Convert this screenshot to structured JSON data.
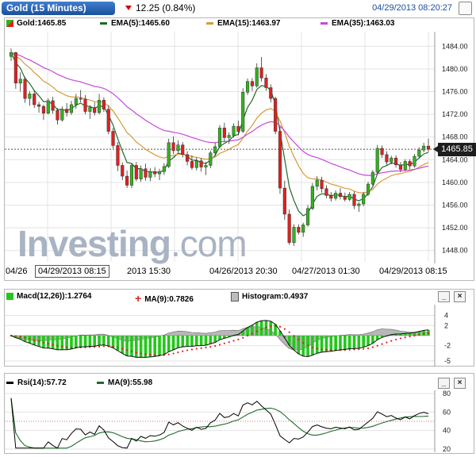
{
  "header": {
    "title": "Gold (15 Minutes)",
    "change": "12.25 (0.84%)",
    "timestamp": "04/29/2013 08:20:27"
  },
  "colors": {
    "up": "#33b21e",
    "down": "#e02020",
    "ema5": "#1f6b2a",
    "ema15": "#d69a3a",
    "ema35": "#c649d8",
    "macd_hist": "#22c81a",
    "macd_signal": "#e02020",
    "rsi": "#000000",
    "rsi_ma": "#1f6b2a",
    "grid": "#e3e3e3"
  },
  "main_legend": {
    "gold": "Gold:1465.85",
    "ema5": "EMA(5):1465.60",
    "ema15": "EMA(15):1463.97",
    "ema35": "EMA(35):1463.03"
  },
  "watermark": {
    "bold": "Investing",
    "light": ".com"
  },
  "current_price_label": "1465.85",
  "x_labels": [
    {
      "text": "04/26",
      "boxed": false
    },
    {
      "text": "04/29/2013 08:15",
      "boxed": true
    },
    {
      "text": "2013 15:30",
      "boxed": false
    },
    {
      "text": "04/26/2013 20:30",
      "boxed": false
    },
    {
      "text": "04/27/2013 01:30",
      "boxed": false
    },
    {
      "text": "04/29/2013 08:15",
      "boxed": false
    }
  ],
  "macd_legend": {
    "macd": "Macd(12,26)):1.2764",
    "ma": "MA(9):0.7826",
    "hist": "Histogram:0.4937"
  },
  "rsi_legend": {
    "rsi": "Rsi(14):57.72",
    "ma": "MA(9):55.98"
  },
  "panel_buttons": {
    "minimize": "_",
    "close": "×"
  },
  "chart_data": [
    {
      "type": "candlestick",
      "name": "Gold",
      "ylim": [
        1446,
        1486
      ],
      "yticks": [
        1448,
        1452,
        1456,
        1460,
        1464,
        1468,
        1472,
        1476,
        1480,
        1484
      ],
      "current": 1465.85,
      "grid": true,
      "candles": [
        [
          1482.2,
          1483.6,
          1481.4,
          1482.9
        ],
        [
          1482.9,
          1483.0,
          1476.5,
          1477.5
        ],
        [
          1477.5,
          1479.4,
          1476.0,
          1478.2
        ],
        [
          1478.2,
          1478.6,
          1474.0,
          1474.8
        ],
        [
          1474.8,
          1476.1,
          1473.5,
          1475.6
        ],
        [
          1475.6,
          1476.2,
          1473.1,
          1473.7
        ],
        [
          1473.7,
          1474.2,
          1472.3,
          1473.4
        ],
        [
          1473.4,
          1473.7,
          1471.0,
          1472.2
        ],
        [
          1472.2,
          1474.8,
          1472.0,
          1474.4
        ],
        [
          1474.4,
          1475.1,
          1472.1,
          1472.7
        ],
        [
          1472.7,
          1473.1,
          1470.2,
          1471.0
        ],
        [
          1471.0,
          1473.4,
          1470.7,
          1472.9
        ],
        [
          1472.9,
          1474.0,
          1471.6,
          1472.3
        ],
        [
          1472.3,
          1474.4,
          1471.9,
          1473.7
        ],
        [
          1473.7,
          1475.6,
          1473.0,
          1474.8
        ],
        [
          1474.8,
          1476.3,
          1474.1,
          1474.7
        ],
        [
          1474.7,
          1475.4,
          1472.0,
          1472.5
        ],
        [
          1472.5,
          1473.6,
          1471.2,
          1473.2
        ],
        [
          1473.2,
          1474.1,
          1471.8,
          1472.3
        ],
        [
          1472.3,
          1475.6,
          1472.0,
          1474.5
        ],
        [
          1474.5,
          1475.0,
          1472.4,
          1472.9
        ],
        [
          1472.9,
          1473.6,
          1468.5,
          1469.0
        ],
        [
          1469.0,
          1469.6,
          1466.0,
          1466.5
        ],
        [
          1466.5,
          1467.1,
          1462.0,
          1463.0
        ],
        [
          1463.0,
          1463.5,
          1460.4,
          1461.1
        ],
        [
          1461.1,
          1462.1,
          1459.0,
          1459.5
        ],
        [
          1459.5,
          1463.4,
          1459.0,
          1463.0
        ],
        [
          1463.0,
          1463.6,
          1460.2,
          1460.6
        ],
        [
          1460.6,
          1463.0,
          1460.1,
          1462.4
        ],
        [
          1462.4,
          1463.3,
          1460.3,
          1460.9
        ],
        [
          1460.9,
          1462.5,
          1460.2,
          1461.9
        ],
        [
          1461.9,
          1462.7,
          1460.9,
          1461.5
        ],
        [
          1461.5,
          1462.4,
          1460.4,
          1461.9
        ],
        [
          1461.9,
          1463.4,
          1461.3,
          1462.8
        ],
        [
          1462.8,
          1467.7,
          1462.5,
          1467.0
        ],
        [
          1467.0,
          1468.1,
          1465.0,
          1465.6
        ],
        [
          1465.6,
          1467.4,
          1465.2,
          1466.6
        ],
        [
          1466.6,
          1467.1,
          1464.4,
          1464.9
        ],
        [
          1464.9,
          1465.5,
          1463.0,
          1463.7
        ],
        [
          1463.7,
          1464.8,
          1462.2,
          1462.6
        ],
        [
          1462.6,
          1464.4,
          1462.1,
          1463.8
        ],
        [
          1463.8,
          1464.3,
          1461.9,
          1462.7
        ],
        [
          1462.7,
          1463.6,
          1461.3,
          1463.0
        ],
        [
          1463.0,
          1465.6,
          1462.5,
          1465.2
        ],
        [
          1465.2,
          1467.0,
          1464.7,
          1466.3
        ],
        [
          1466.3,
          1470.1,
          1466.0,
          1469.6
        ],
        [
          1469.6,
          1470.5,
          1467.2,
          1467.9
        ],
        [
          1467.9,
          1468.8,
          1466.8,
          1468.3
        ],
        [
          1468.3,
          1470.4,
          1467.9,
          1469.9
        ],
        [
          1469.9,
          1470.9,
          1468.3,
          1469.0
        ],
        [
          1469.0,
          1476.6,
          1468.7,
          1475.9
        ],
        [
          1475.9,
          1478.3,
          1475.4,
          1477.8
        ],
        [
          1477.8,
          1478.4,
          1476.1,
          1477.0
        ],
        [
          1477.0,
          1481.0,
          1476.7,
          1480.2
        ],
        [
          1480.2,
          1482.1,
          1477.8,
          1478.4
        ],
        [
          1478.4,
          1479.1,
          1476.2,
          1476.7
        ],
        [
          1476.7,
          1477.3,
          1474.1,
          1474.8
        ],
        [
          1474.8,
          1475.1,
          1468.5,
          1469.0
        ],
        [
          1469.0,
          1469.8,
          1458.0,
          1459.0
        ],
        [
          1459.0,
          1460.3,
          1453.4,
          1454.4
        ],
        [
          1454.4,
          1455.2,
          1449.0,
          1449.4
        ],
        [
          1449.4,
          1452.6,
          1448.8,
          1452.1
        ],
        [
          1452.1,
          1452.6,
          1450.8,
          1451.2
        ],
        [
          1451.2,
          1452.9,
          1450.4,
          1452.5
        ],
        [
          1452.5,
          1456.0,
          1452.2,
          1455.4
        ],
        [
          1455.4,
          1459.9,
          1455.1,
          1459.3
        ],
        [
          1459.3,
          1461.1,
          1458.6,
          1460.4
        ],
        [
          1460.4,
          1461.0,
          1458.2,
          1458.9
        ],
        [
          1458.9,
          1459.5,
          1457.2,
          1457.7
        ],
        [
          1457.7,
          1458.3,
          1456.6,
          1457.2
        ],
        [
          1457.2,
          1458.6,
          1456.8,
          1458.1
        ],
        [
          1458.1,
          1459.0,
          1457.0,
          1457.5
        ],
        [
          1457.5,
          1458.2,
          1456.6,
          1457.0
        ],
        [
          1457.0,
          1458.3,
          1456.7,
          1457.9
        ],
        [
          1457.9,
          1458.4,
          1455.3,
          1455.9
        ],
        [
          1455.9,
          1456.5,
          1454.8,
          1456.2
        ],
        [
          1456.2,
          1458.3,
          1455.8,
          1457.9
        ],
        [
          1457.9,
          1460.1,
          1457.6,
          1459.7
        ],
        [
          1459.7,
          1462.2,
          1459.4,
          1461.8
        ],
        [
          1461.8,
          1466.6,
          1461.4,
          1466.0
        ],
        [
          1466.0,
          1466.5,
          1464.3,
          1464.9
        ],
        [
          1464.9,
          1465.5,
          1463.1,
          1463.6
        ],
        [
          1463.6,
          1464.7,
          1463.2,
          1464.3
        ],
        [
          1464.3,
          1464.8,
          1462.6,
          1463.1
        ],
        [
          1463.1,
          1463.6,
          1461.8,
          1462.3
        ],
        [
          1462.3,
          1464.1,
          1462.0,
          1463.7
        ],
        [
          1463.7,
          1464.1,
          1462.3,
          1462.9
        ],
        [
          1462.9,
          1465.0,
          1462.6,
          1464.6
        ],
        [
          1464.6,
          1466.2,
          1464.3,
          1465.7
        ],
        [
          1465.7,
          1467.0,
          1465.3,
          1466.4
        ],
        [
          1466.4,
          1467.7,
          1465.4,
          1465.85
        ]
      ],
      "ema_periods": [
        5,
        15,
        35
      ]
    },
    {
      "type": "macd",
      "name": "Macd(12,26))",
      "ylim": [
        -5.5,
        5.5
      ],
      "yticks": [
        4,
        2,
        -2,
        -5
      ],
      "signal_period": 9
    },
    {
      "type": "line",
      "name": "Rsi(14)",
      "ylim": [
        20,
        80
      ],
      "yticks": [
        80,
        60,
        40,
        20
      ],
      "reference_lines": [
        30,
        50,
        70
      ],
      "period": 14,
      "ma_period": 9
    }
  ]
}
